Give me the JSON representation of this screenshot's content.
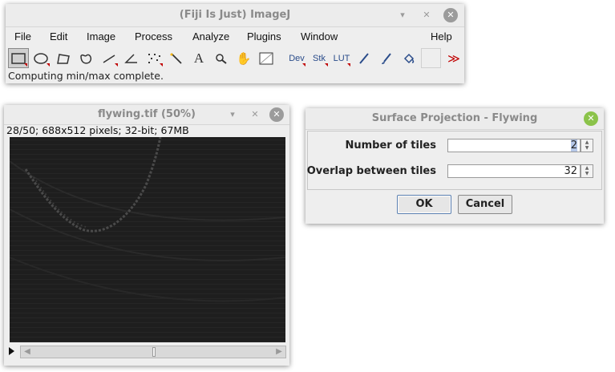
{
  "main_window": {
    "title": "(Fiji Is Just) ImageJ",
    "menus": [
      "File",
      "Edit",
      "Image",
      "Process",
      "Analyze",
      "Plugins",
      "Window",
      "Help"
    ],
    "tools": [
      "rectangle-tool",
      "oval-tool",
      "polygon-tool",
      "freehand-tool",
      "line-tool",
      "angle-tool",
      "point-tool",
      "wand-tool",
      "text-tool",
      "magnifier-tool",
      "hand-tool",
      "color-picker-tool"
    ],
    "extra_tools": {
      "dev": "Dev",
      "stk": "Stk",
      "lut": "LUT"
    },
    "status": "Computing min/max complete."
  },
  "image_window": {
    "title": "flywing.tif (50%)",
    "info": "28/50; 688x512 pixels; 32-bit; 67MB",
    "slice_position": 0.5
  },
  "dialog": {
    "title": "Surface Projection - Flywing",
    "fields": [
      {
        "label": "Number of tiles",
        "value": "2"
      },
      {
        "label": "Overlap between tiles",
        "value": "32"
      }
    ],
    "ok_label": "OK",
    "cancel_label": "Cancel"
  },
  "colors": {
    "accent_green": "#8bc34a",
    "tool_marker": "#c00000"
  }
}
